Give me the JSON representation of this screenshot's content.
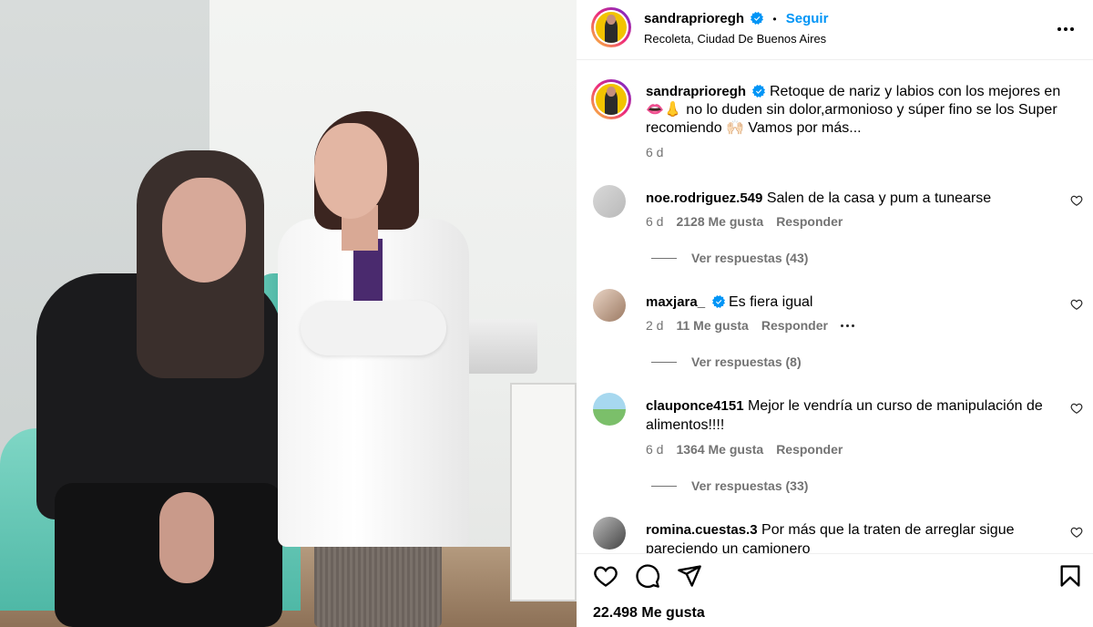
{
  "post": {
    "author": "sandraprioregh",
    "follow_label": "Seguir",
    "location": "Recoleta, Ciudad De Buenos Aires",
    "caption_text": "Retoque de nariz y labios con los mejores en 👄👃 no lo duden sin dolor,armonioso y súper fino se los Super recomiendo 🙌🏻 Vamos por más...",
    "caption_time": "6 d",
    "likes": "22.498 Me gusta"
  },
  "comments": [
    {
      "user": "noe.rodriguez.549",
      "verified": false,
      "text": "Salen de la casa y pum a tunearse",
      "time": "6 d",
      "likes": "2128 Me gusta",
      "reply_label": "Responder",
      "view_replies": "Ver respuestas (43)"
    },
    {
      "user": "maxjara_",
      "verified": true,
      "text": "Es fiera igual",
      "time": "2 d",
      "likes": "11 Me gusta",
      "reply_label": "Responder",
      "view_replies": "Ver respuestas (8)"
    },
    {
      "user": "clauponce4151",
      "verified": false,
      "text": "Mejor le vendría un curso de manipulación de alimentos!!!!",
      "time": "6 d",
      "likes": "1364 Me gusta",
      "reply_label": "Responder",
      "view_replies": "Ver respuestas (33)"
    },
    {
      "user": "romina.cuestas.3",
      "verified": false,
      "text": "Por más que la traten de arreglar sigue pareciendo un camionero"
    }
  ],
  "icons": {
    "like": "heart-icon",
    "comment": "comment-icon",
    "share": "send-icon",
    "save": "bookmark-icon",
    "more": "more-options-icon",
    "verified": "verified-badge-icon"
  },
  "colors": {
    "accent": "#0095f6",
    "muted": "#737373",
    "verified": "#0095f6"
  }
}
